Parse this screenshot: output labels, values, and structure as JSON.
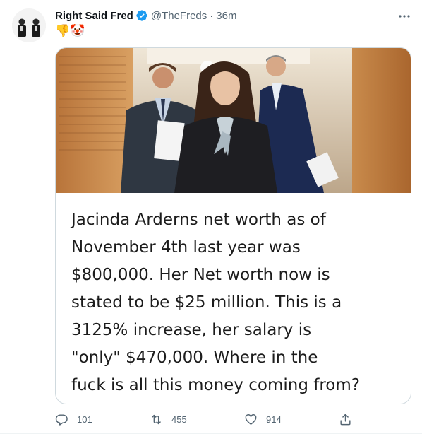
{
  "tweet": {
    "display_name": "Right Said Fred",
    "handle": "@TheFreds",
    "separator": "·",
    "timestamp": "36m",
    "text": "👎🤡",
    "verified_icon": "verified-badge-icon",
    "more_icon": "more-horizontal-icon"
  },
  "media": {
    "photo_icon": "news-photo",
    "caption": "Jacinda Arderns net worth as of\nNovember 4th last year was\n$800,000. Her Net worth now is\nstated to be $25 million. This is a\n3125% increase, her salary is\n\"only\" $470,000. Where in the\nfuck is all this money coming from?"
  },
  "actions": {
    "reply_count": "101",
    "retweet_count": "455",
    "like_count": "914",
    "reply_icon": "reply-icon",
    "retweet_icon": "retweet-icon",
    "like_icon": "heart-icon",
    "share_icon": "share-icon"
  },
  "colors": {
    "verified": "#1d9bf0",
    "secondary_text": "#536471",
    "border": "#cfd9de"
  }
}
